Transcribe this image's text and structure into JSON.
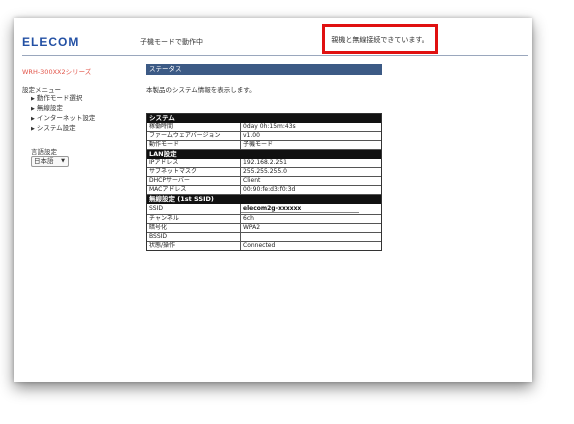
{
  "header": {
    "logo": "ELECOM",
    "mode": "子機モードで動作中",
    "connection": "親機と無線接続できています。"
  },
  "sidebar": {
    "series": "WRH-300XX2シリーズ",
    "menu_title": "設定メニュー",
    "items": [
      {
        "label": "動作モード選択"
      },
      {
        "label": "無線設定"
      },
      {
        "label": "インターネット設定"
      },
      {
        "label": "システム設定"
      }
    ],
    "language_title": "言語設定",
    "language_value": "日本語"
  },
  "main": {
    "header": "ステータス",
    "intro": "本製品のシステム情報を表示します。",
    "sections": [
      {
        "title": "システム",
        "rows": [
          {
            "key": "稼働時間",
            "value": "0day 0h:15m:43s"
          },
          {
            "key": "ファームウェアバージョン",
            "value": "v1.00"
          },
          {
            "key": "動作モード",
            "value": "子機モード"
          }
        ]
      },
      {
        "title": "LAN設定",
        "rows": [
          {
            "key": "IPアドレス",
            "value": "192.168.2.251"
          },
          {
            "key": "サブネットマスク",
            "value": "255.255.255.0"
          },
          {
            "key": "DHCPサーバー",
            "value": "Client"
          },
          {
            "key": "MACアドレス",
            "value": "00:90:fe:d3:f0:3d"
          }
        ]
      },
      {
        "title": "無線設定 (1st SSID)",
        "rows": [
          {
            "key": "SSID",
            "value": "elecom2g-xxxxxx"
          },
          {
            "key": "チャンネル",
            "value": "6ch"
          },
          {
            "key": "暗号化",
            "value": "WPA2"
          },
          {
            "key": "BSSID",
            "value": ""
          },
          {
            "key": "状態/操作",
            "value": "Connected"
          }
        ]
      }
    ]
  },
  "colors": {
    "logo": "#2350a4",
    "series": "#e2554a",
    "status_header": "#3c5a85",
    "highlight_box": "#e01010"
  }
}
